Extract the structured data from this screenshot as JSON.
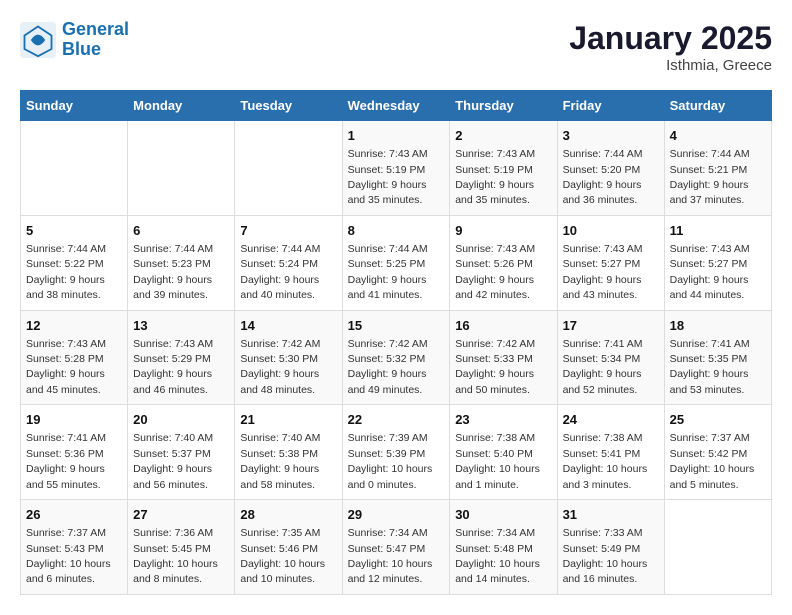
{
  "header": {
    "logo_line1": "General",
    "logo_line2": "Blue",
    "month": "January 2025",
    "location": "Isthmia, Greece"
  },
  "days_of_week": [
    "Sunday",
    "Monday",
    "Tuesday",
    "Wednesday",
    "Thursday",
    "Friday",
    "Saturday"
  ],
  "weeks": [
    [
      {
        "num": "",
        "info": ""
      },
      {
        "num": "",
        "info": ""
      },
      {
        "num": "",
        "info": ""
      },
      {
        "num": "1",
        "info": "Sunrise: 7:43 AM\nSunset: 5:19 PM\nDaylight: 9 hours and 35 minutes."
      },
      {
        "num": "2",
        "info": "Sunrise: 7:43 AM\nSunset: 5:19 PM\nDaylight: 9 hours and 35 minutes."
      },
      {
        "num": "3",
        "info": "Sunrise: 7:44 AM\nSunset: 5:20 PM\nDaylight: 9 hours and 36 minutes."
      },
      {
        "num": "4",
        "info": "Sunrise: 7:44 AM\nSunset: 5:21 PM\nDaylight: 9 hours and 37 minutes."
      }
    ],
    [
      {
        "num": "5",
        "info": "Sunrise: 7:44 AM\nSunset: 5:22 PM\nDaylight: 9 hours and 38 minutes."
      },
      {
        "num": "6",
        "info": "Sunrise: 7:44 AM\nSunset: 5:23 PM\nDaylight: 9 hours and 39 minutes."
      },
      {
        "num": "7",
        "info": "Sunrise: 7:44 AM\nSunset: 5:24 PM\nDaylight: 9 hours and 40 minutes."
      },
      {
        "num": "8",
        "info": "Sunrise: 7:44 AM\nSunset: 5:25 PM\nDaylight: 9 hours and 41 minutes."
      },
      {
        "num": "9",
        "info": "Sunrise: 7:43 AM\nSunset: 5:26 PM\nDaylight: 9 hours and 42 minutes."
      },
      {
        "num": "10",
        "info": "Sunrise: 7:43 AM\nSunset: 5:27 PM\nDaylight: 9 hours and 43 minutes."
      },
      {
        "num": "11",
        "info": "Sunrise: 7:43 AM\nSunset: 5:27 PM\nDaylight: 9 hours and 44 minutes."
      }
    ],
    [
      {
        "num": "12",
        "info": "Sunrise: 7:43 AM\nSunset: 5:28 PM\nDaylight: 9 hours and 45 minutes."
      },
      {
        "num": "13",
        "info": "Sunrise: 7:43 AM\nSunset: 5:29 PM\nDaylight: 9 hours and 46 minutes."
      },
      {
        "num": "14",
        "info": "Sunrise: 7:42 AM\nSunset: 5:30 PM\nDaylight: 9 hours and 48 minutes."
      },
      {
        "num": "15",
        "info": "Sunrise: 7:42 AM\nSunset: 5:32 PM\nDaylight: 9 hours and 49 minutes."
      },
      {
        "num": "16",
        "info": "Sunrise: 7:42 AM\nSunset: 5:33 PM\nDaylight: 9 hours and 50 minutes."
      },
      {
        "num": "17",
        "info": "Sunrise: 7:41 AM\nSunset: 5:34 PM\nDaylight: 9 hours and 52 minutes."
      },
      {
        "num": "18",
        "info": "Sunrise: 7:41 AM\nSunset: 5:35 PM\nDaylight: 9 hours and 53 minutes."
      }
    ],
    [
      {
        "num": "19",
        "info": "Sunrise: 7:41 AM\nSunset: 5:36 PM\nDaylight: 9 hours and 55 minutes."
      },
      {
        "num": "20",
        "info": "Sunrise: 7:40 AM\nSunset: 5:37 PM\nDaylight: 9 hours and 56 minutes."
      },
      {
        "num": "21",
        "info": "Sunrise: 7:40 AM\nSunset: 5:38 PM\nDaylight: 9 hours and 58 minutes."
      },
      {
        "num": "22",
        "info": "Sunrise: 7:39 AM\nSunset: 5:39 PM\nDaylight: 10 hours and 0 minutes."
      },
      {
        "num": "23",
        "info": "Sunrise: 7:38 AM\nSunset: 5:40 PM\nDaylight: 10 hours and 1 minute."
      },
      {
        "num": "24",
        "info": "Sunrise: 7:38 AM\nSunset: 5:41 PM\nDaylight: 10 hours and 3 minutes."
      },
      {
        "num": "25",
        "info": "Sunrise: 7:37 AM\nSunset: 5:42 PM\nDaylight: 10 hours and 5 minutes."
      }
    ],
    [
      {
        "num": "26",
        "info": "Sunrise: 7:37 AM\nSunset: 5:43 PM\nDaylight: 10 hours and 6 minutes."
      },
      {
        "num": "27",
        "info": "Sunrise: 7:36 AM\nSunset: 5:45 PM\nDaylight: 10 hours and 8 minutes."
      },
      {
        "num": "28",
        "info": "Sunrise: 7:35 AM\nSunset: 5:46 PM\nDaylight: 10 hours and 10 minutes."
      },
      {
        "num": "29",
        "info": "Sunrise: 7:34 AM\nSunset: 5:47 PM\nDaylight: 10 hours and 12 minutes."
      },
      {
        "num": "30",
        "info": "Sunrise: 7:34 AM\nSunset: 5:48 PM\nDaylight: 10 hours and 14 minutes."
      },
      {
        "num": "31",
        "info": "Sunrise: 7:33 AM\nSunset: 5:49 PM\nDaylight: 10 hours and 16 minutes."
      },
      {
        "num": "",
        "info": ""
      }
    ]
  ]
}
